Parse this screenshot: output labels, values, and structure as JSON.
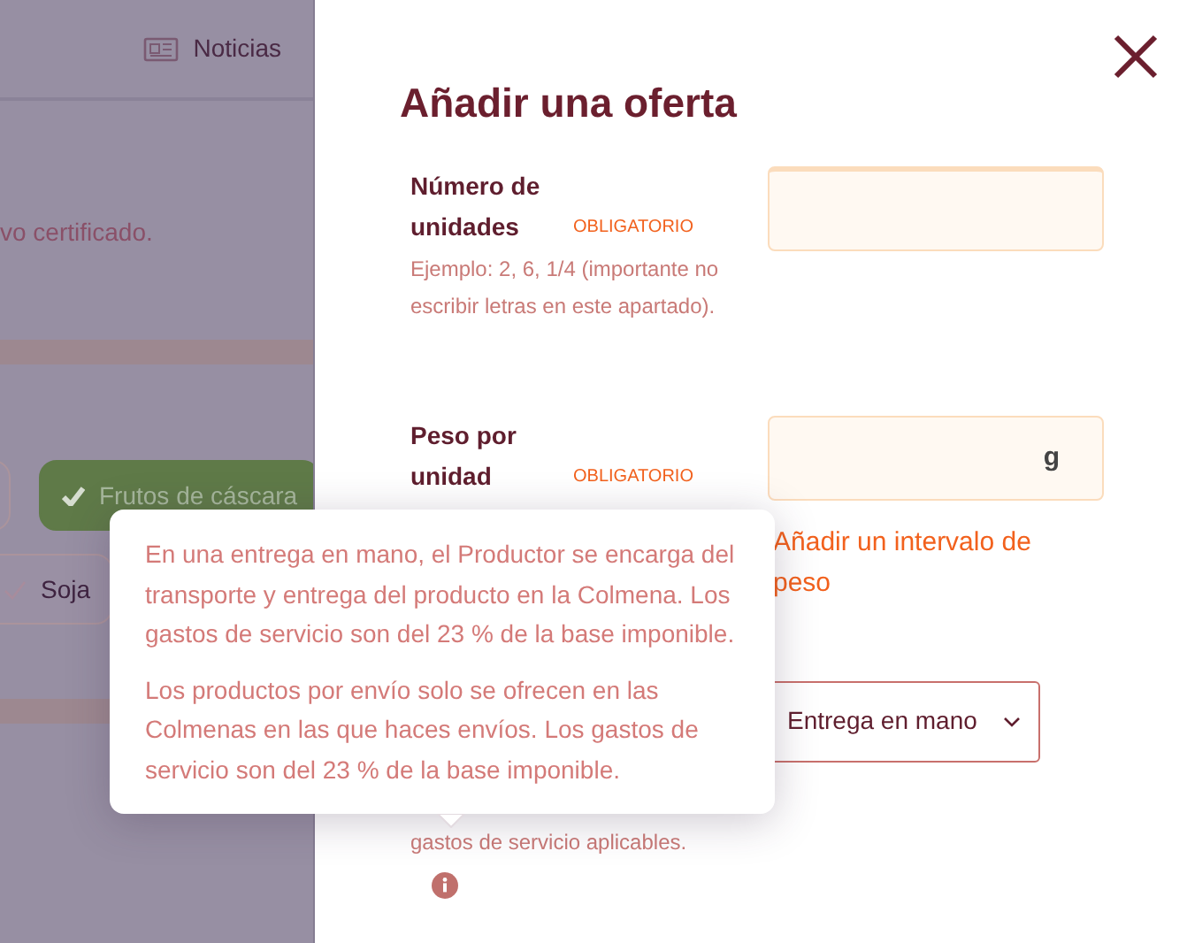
{
  "background_page": {
    "nav_link": "Noticias",
    "text_fragment": "vo certificado.",
    "chips": [
      {
        "label": "Frutos de cáscara",
        "selected": true
      },
      {
        "label": "Soja",
        "selected": false
      }
    ]
  },
  "offer_panel": {
    "title": "Añadir una oferta",
    "fields": [
      {
        "kind": "text",
        "label": "Número de unidades",
        "required": "OBLIGATORIO",
        "hint": "Ejemplo: 2, 6, 1/4 (importante no escribir letras en este apartado)."
      },
      {
        "kind": "text",
        "label": "Peso por unidad",
        "required": "OBLIGATORIO",
        "suffix": "g",
        "link": "Añadir un intervalo de peso"
      },
      {
        "kind": "select",
        "value": "Entrega en mano",
        "hint": "gastos de servicio aplicables."
      }
    ]
  },
  "tooltip": {
    "paragraphs": [
      "En una entrega en mano, el Productor se encarga del transporte y entrega del producto en la Colmena. Los gastos de servicio son del 23 % de la base imponible.",
      "Los productos por envío solo se ofrecen en las Colmenas en las que haces envíos. Los gastos de servicio son del 23 % de la base imponible."
    ]
  }
}
